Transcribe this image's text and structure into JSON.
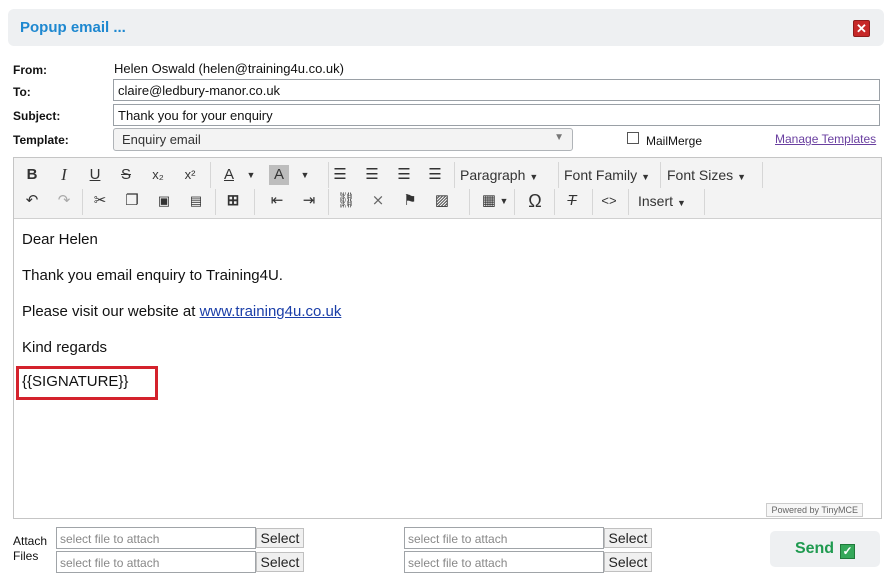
{
  "dialog": {
    "title": "Popup email ...",
    "close_icon": "close-icon"
  },
  "form": {
    "from_label": "From:",
    "from_value": "Helen Oswald (helen@training4u.co.uk)",
    "to_label": "To:",
    "to_value": "claire@ledbury-manor.co.uk",
    "subject_label": "Subject:",
    "subject_value": "Thank you for your enquiry",
    "template_label": "Template:",
    "template_value": "Enquiry email",
    "mailmerge_label": "MailMerge",
    "mailmerge_checked": false,
    "manage_templates": "Manage Templates"
  },
  "toolbar": {
    "row1": [
      {
        "name": "bold-icon",
        "glyph": "B"
      },
      {
        "name": "italic-icon",
        "glyph": "I"
      },
      {
        "name": "underline-icon",
        "glyph": "U"
      },
      {
        "name": "strikethrough-icon",
        "glyph": "S"
      },
      {
        "name": "subscript-icon",
        "glyph": "x₂"
      },
      {
        "name": "superscript-icon",
        "glyph": "x²"
      },
      {
        "name": "text-color-icon",
        "glyph": "A"
      },
      {
        "name": "background-color-icon",
        "glyph": "A"
      },
      {
        "name": "align-left-icon",
        "glyph": "≡"
      },
      {
        "name": "align-center-icon",
        "glyph": "≡"
      },
      {
        "name": "align-right-icon",
        "glyph": "≡"
      },
      {
        "name": "align-justify-icon",
        "glyph": "≡"
      }
    ],
    "paragraph_label": "Paragraph",
    "font_family_label": "Font Family",
    "font_sizes_label": "Font Sizes",
    "row2": [
      {
        "name": "undo-icon",
        "glyph": "↶"
      },
      {
        "name": "redo-icon",
        "glyph": "↷"
      },
      {
        "name": "cut-icon",
        "glyph": "✂"
      },
      {
        "name": "copy-icon",
        "glyph": "❐"
      },
      {
        "name": "paste-icon",
        "glyph": "📋"
      },
      {
        "name": "paste-text-icon",
        "glyph": "📋"
      },
      {
        "name": "find-icon",
        "glyph": "🔭"
      },
      {
        "name": "outdent-icon",
        "glyph": "⇤"
      },
      {
        "name": "indent-icon",
        "glyph": "⇥"
      },
      {
        "name": "link-icon",
        "glyph": "🔗"
      },
      {
        "name": "unlink-icon",
        "glyph": "⛓"
      },
      {
        "name": "anchor-icon",
        "glyph": "🔖"
      },
      {
        "name": "image-icon",
        "glyph": "🖼"
      },
      {
        "name": "table-icon",
        "glyph": "▦"
      },
      {
        "name": "special-char-icon",
        "glyph": "Ω"
      },
      {
        "name": "clear-format-icon",
        "glyph": "Tx"
      },
      {
        "name": "code-icon",
        "glyph": "<>"
      }
    ],
    "insert_label": "Insert"
  },
  "editor": {
    "greeting": "Dear Helen",
    "line1": "Thank you email enquiry to Training4U.",
    "line2_prefix": "Please visit our website at ",
    "line2_link": "www.training4u.co.uk",
    "closing": "Kind regards",
    "signature": "{{SIGNATURE}}",
    "powered_by": "Powered by TinyMCE"
  },
  "attachments": {
    "label_line1": "Attach",
    "label_line2": "Files",
    "placeholder": "select file to attach",
    "select_label": "Select"
  },
  "send": {
    "label": "Send",
    "icon": "check-icon"
  },
  "colors": {
    "title_blue": "#1e88d0",
    "send_green": "#1f9a50",
    "highlight_red": "#d4222c"
  }
}
